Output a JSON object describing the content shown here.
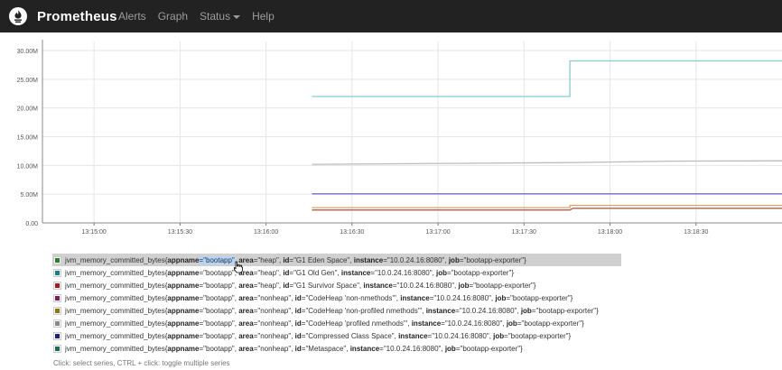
{
  "navbar": {
    "brand": "Prometheus",
    "items": [
      {
        "label": "Alerts"
      },
      {
        "label": "Graph"
      },
      {
        "label": "Status",
        "dropdown": true
      },
      {
        "label": "Help"
      }
    ]
  },
  "chart_data": {
    "type": "line",
    "y_ticks": [
      "30.00M",
      "25.00M",
      "20.00M",
      "15.00M",
      "10.00M",
      "5.00M",
      "0.00"
    ],
    "y_tick_values": [
      30000000,
      25000000,
      20000000,
      15000000,
      10000000,
      5000000,
      0
    ],
    "ylim": [
      0,
      30000000
    ],
    "x_ticks": [
      "13:15:00",
      "13:15:30",
      "13:16:00",
      "13:16:30",
      "13:17:00",
      "13:17:30",
      "13:18:00",
      "13:18:30"
    ],
    "x_tick_seconds": [
      0,
      30,
      60,
      90,
      120,
      150,
      180,
      210
    ],
    "xlim_seconds": [
      -18,
      240
    ],
    "grid": true,
    "series": [
      {
        "color": "#87cccc",
        "x": [
          76,
          166,
          166,
          240
        ],
        "y": [
          22000000,
          22000000,
          28200000,
          28200000
        ]
      },
      {
        "color": "#bbbbbb",
        "x": [
          76,
          165,
          200,
          240
        ],
        "y": [
          10200000,
          10500000,
          10750000,
          10800000
        ]
      },
      {
        "color": "#7a66cc",
        "x": [
          76,
          240
        ],
        "y": [
          5050000,
          5050000
        ]
      },
      {
        "color": "#e0a060",
        "x": [
          76,
          166,
          166,
          240
        ],
        "y": [
          2650000,
          2650000,
          3050000,
          3050000
        ]
      },
      {
        "color": "#a86458",
        "x": [
          76,
          166,
          167,
          240
        ],
        "y": [
          2250000,
          2250000,
          2550000,
          2550000
        ]
      }
    ]
  },
  "legend": {
    "items": [
      {
        "color": "#2e7d32",
        "metric": "jvm_memory_committed_bytes",
        "labels": [
          [
            "appname",
            "bootapp"
          ],
          [
            "area",
            "heap"
          ],
          [
            "id",
            "G1 Eden Space"
          ],
          [
            "instance",
            "10.0.24.16:8080"
          ],
          [
            "job",
            "bootapp-exporter"
          ]
        ],
        "selected": true,
        "highlight_first_value": true
      },
      {
        "color": "#1b7f8a",
        "metric": "jvm_memory_committed_bytes",
        "labels": [
          [
            "appname",
            "bootapp"
          ],
          [
            "area",
            "heap"
          ],
          [
            "id",
            "G1 Old Gen"
          ],
          [
            "instance",
            "10.0.24.16:8080"
          ],
          [
            "job",
            "bootapp-exporter"
          ]
        ]
      },
      {
        "color": "#a61b1b",
        "metric": "jvm_memory_committed_bytes",
        "labels": [
          [
            "appname",
            "bootapp"
          ],
          [
            "area",
            "heap"
          ],
          [
            "id",
            "G1 Survivor Space"
          ],
          [
            "instance",
            "10.0.24.16:8080"
          ],
          [
            "job",
            "bootapp-exporter"
          ]
        ]
      },
      {
        "color": "#7a1f5c",
        "metric": "jvm_memory_committed_bytes",
        "labels": [
          [
            "appname",
            "bootapp"
          ],
          [
            "area",
            "nonheap"
          ],
          [
            "id",
            "CodeHeap 'non-nmethods'"
          ],
          [
            "instance",
            "10.0.24.16:8080"
          ],
          [
            "job",
            "bootapp-exporter"
          ]
        ]
      },
      {
        "color": "#8a7a10",
        "metric": "jvm_memory_committed_bytes",
        "labels": [
          [
            "appname",
            "bootapp"
          ],
          [
            "area",
            "nonheap"
          ],
          [
            "id",
            "CodeHeap 'non-profiled nmethods'"
          ],
          [
            "instance",
            "10.0.24.16:8080"
          ],
          [
            "job",
            "bootapp-exporter"
          ]
        ]
      },
      {
        "color": "#888888",
        "metric": "jvm_memory_committed_bytes",
        "labels": [
          [
            "appname",
            "bootapp"
          ],
          [
            "area",
            "nonheap"
          ],
          [
            "id",
            "CodeHeap 'profiled nmethods'"
          ],
          [
            "instance",
            "10.0.24.16:8080"
          ],
          [
            "job",
            "bootapp-exporter"
          ]
        ]
      },
      {
        "color": "#1a237e",
        "metric": "jvm_memory_committed_bytes",
        "labels": [
          [
            "appname",
            "bootapp"
          ],
          [
            "area",
            "nonheap"
          ],
          [
            "id",
            "Compressed Class Space"
          ],
          [
            "instance",
            "10.0.24.16:8080"
          ],
          [
            "job",
            "bootapp-exporter"
          ]
        ]
      },
      {
        "color": "#1f6b4f",
        "metric": "jvm_memory_committed_bytes",
        "labels": [
          [
            "appname",
            "bootapp"
          ],
          [
            "area",
            "nonheap"
          ],
          [
            "id",
            "Metaspace"
          ],
          [
            "instance",
            "10.0.24.16:8080"
          ],
          [
            "job",
            "bootapp-exporter"
          ]
        ]
      }
    ],
    "hint": "Click: select series, CTRL + click: toggle multiple series"
  }
}
